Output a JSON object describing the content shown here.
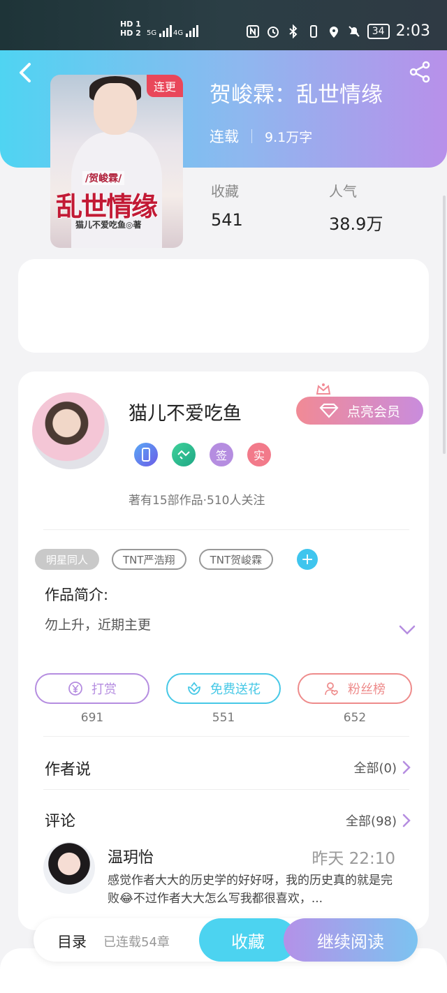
{
  "status_bar": {
    "sim1": "HD 1",
    "sim2": "HD 2",
    "net1": "5G",
    "net2": "4G",
    "battery": "34",
    "time": "2:03"
  },
  "book": {
    "title": "贺峻霖：乱世情缘",
    "status": "连载",
    "words": "9.1万字",
    "cover_tag": "连更",
    "cover_subtitle": "/贺峻霖/",
    "cover_title": "乱世情缘",
    "cover_author": "猫儿不爱吃鱼◎著",
    "favorites_label": "收藏",
    "favorites_value": "541",
    "popularity_label": "人气",
    "popularity_value": "38.9万"
  },
  "author": {
    "name": "猫儿不爱吃鱼",
    "vip_label": "点亮会员",
    "badges": [
      "",
      "",
      "签",
      "实"
    ],
    "stats": "著有15部作品·510人关注"
  },
  "tags": [
    "明星同人",
    "TNT严浩翔",
    "TNT贺峻霖"
  ],
  "intro": {
    "title": "作品简介:",
    "text": "勿上升，近期主更"
  },
  "actions": [
    {
      "label": "打赏",
      "count": "691",
      "color": "#b58de0"
    },
    {
      "label": "免费送花",
      "count": "551",
      "color": "#46c8e6"
    },
    {
      "label": "粉丝榜",
      "count": "652",
      "color": "#ee8b8b"
    }
  ],
  "author_says": {
    "title": "作者说",
    "more": "全部(0)"
  },
  "comments": {
    "title": "评论",
    "more": "全部(98)",
    "first": {
      "user": "温玥怡",
      "time": "昨天 22:10",
      "text": "感觉作者大大的历史学的好好呀，我的历史真的就是完败😂不过作者大大怎么写我都很喜欢，..."
    }
  },
  "bottom": {
    "toc": "目录",
    "chapters": "已连载54章",
    "favorite": "收藏",
    "continue": "继续阅读"
  },
  "colors": {
    "header_start": "#4fd4f2",
    "header_end": "#b890ea",
    "accent_purple": "#b58de0",
    "accent_cyan": "#46c8e6"
  }
}
